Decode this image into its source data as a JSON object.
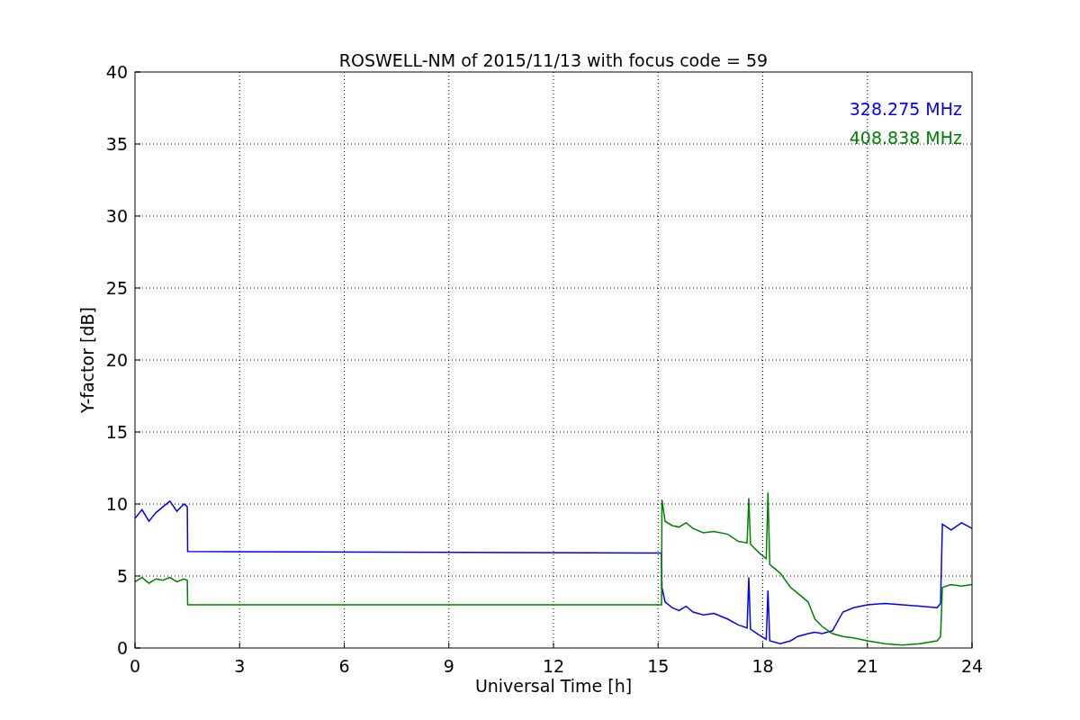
{
  "figure": {
    "chart_data": {
      "type": "line",
      "title": "ROSWELL-NM of 2015/11/13 with focus code = 59",
      "xlabel": "Universal Time [h]",
      "ylabel": "Y-factor [dB]",
      "x": [
        0,
        0.2,
        0.4,
        0.6,
        0.8,
        1.0,
        1.2,
        1.4,
        1.5,
        1.51,
        15.1,
        15.11,
        15.2,
        15.4,
        15.6,
        15.8,
        16,
        16.3,
        16.6,
        17,
        17.3,
        17.55,
        17.6,
        17.65,
        17.9,
        18.1,
        18.15,
        18.2,
        18.5,
        18.8,
        19,
        19.3,
        19.5,
        19.7,
        20,
        20.3,
        20.6,
        21,
        21.5,
        22,
        22.5,
        23,
        23.1,
        23.15,
        23.4,
        23.7,
        24
      ],
      "series": [
        {
          "name": "328.275 MHz",
          "color": "#0000ff",
          "values": [
            9.0,
            9.6,
            8.8,
            9.4,
            9.8,
            10.2,
            9.5,
            10.0,
            9.8,
            6.7,
            6.6,
            4.2,
            3.2,
            2.8,
            2.6,
            2.9,
            2.5,
            2.3,
            2.4,
            2.0,
            1.6,
            1.4,
            4.9,
            1.3,
            0.9,
            0.6,
            4.0,
            0.5,
            0.3,
            0.5,
            0.8,
            1.0,
            1.1,
            1.0,
            1.2,
            2.5,
            2.8,
            3.0,
            3.1,
            3.0,
            2.9,
            2.8,
            3.1,
            8.6,
            8.2,
            8.7,
            8.3
          ]
        },
        {
          "name": "408.838 MHz",
          "color": "#008000",
          "values": [
            4.6,
            4.9,
            4.5,
            4.8,
            4.7,
            4.9,
            4.6,
            4.8,
            4.7,
            3.0,
            3.0,
            10.3,
            8.8,
            8.5,
            8.4,
            8.7,
            8.3,
            8.0,
            8.1,
            7.9,
            7.4,
            7.3,
            10.4,
            7.2,
            6.6,
            6.2,
            10.8,
            5.8,
            5.2,
            4.2,
            3.8,
            3.2,
            2.0,
            1.5,
            1.0,
            0.8,
            0.7,
            0.5,
            0.3,
            0.2,
            0.3,
            0.5,
            0.8,
            4.2,
            4.4,
            4.3,
            4.4
          ]
        }
      ],
      "xlim": [
        0,
        24
      ],
      "ylim": [
        0,
        40
      ],
      "grid": true,
      "xticks": [
        0,
        3,
        6,
        9,
        12,
        15,
        18,
        21,
        24
      ],
      "yticks": [
        0,
        5,
        10,
        15,
        20,
        25,
        30,
        35,
        40
      ]
    }
  }
}
